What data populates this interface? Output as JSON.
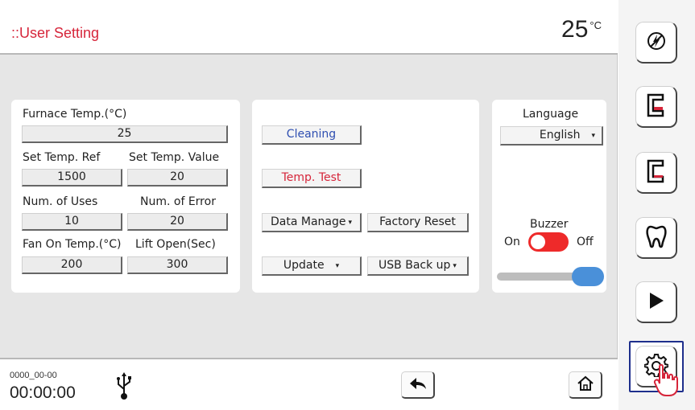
{
  "header": {
    "title": "::User Setting",
    "temperature": "25",
    "temp_unit": "°C"
  },
  "panel_params": {
    "furnace_label": "Furnace Temp.(°C)",
    "furnace_value": "25",
    "set_ref_label": "Set Temp. Ref",
    "set_ref_value": "1500",
    "set_value_label": "Set Temp. Value",
    "set_value_value": "20",
    "uses_label": "Num. of Uses",
    "uses_value": "10",
    "error_label": "Num. of Error",
    "error_value": "20",
    "fan_label": "Fan On Temp.(°C)",
    "fan_value": "200",
    "lift_label": "Lift Open(Sec)",
    "lift_value": "300"
  },
  "panel_actions": {
    "cleaning": "Cleaning",
    "temp_test": "Temp. Test",
    "data_manage": "Data Manage",
    "factory_reset": "Factory Reset",
    "update": "Update",
    "usb_backup": "USB Back up",
    "caret": "▾"
  },
  "panel_settings": {
    "language_label": "Language",
    "language_value": "English",
    "buzzer_label": "Buzzer",
    "buzzer_on": "On",
    "buzzer_off": "Off",
    "buzzer_state": "on",
    "volume_level": 1.0
  },
  "footer": {
    "date": "0000_00-00",
    "time": "00:00:00"
  },
  "sidebar": {
    "items": [
      {
        "icon": "power-disabled-icon"
      },
      {
        "icon": "furnace-icon"
      },
      {
        "icon": "furnace-icon"
      },
      {
        "icon": "tooth-icon"
      },
      {
        "icon": "play-icon"
      },
      {
        "icon": "gear-icon",
        "selected": true
      }
    ]
  },
  "colors": {
    "accent_red": "#d6253a",
    "accent_blue": "#2f4fb1",
    "toggle_red": "#ee2a2a",
    "slider_blue": "#4a90d9",
    "selection": "#1e2f8c"
  }
}
